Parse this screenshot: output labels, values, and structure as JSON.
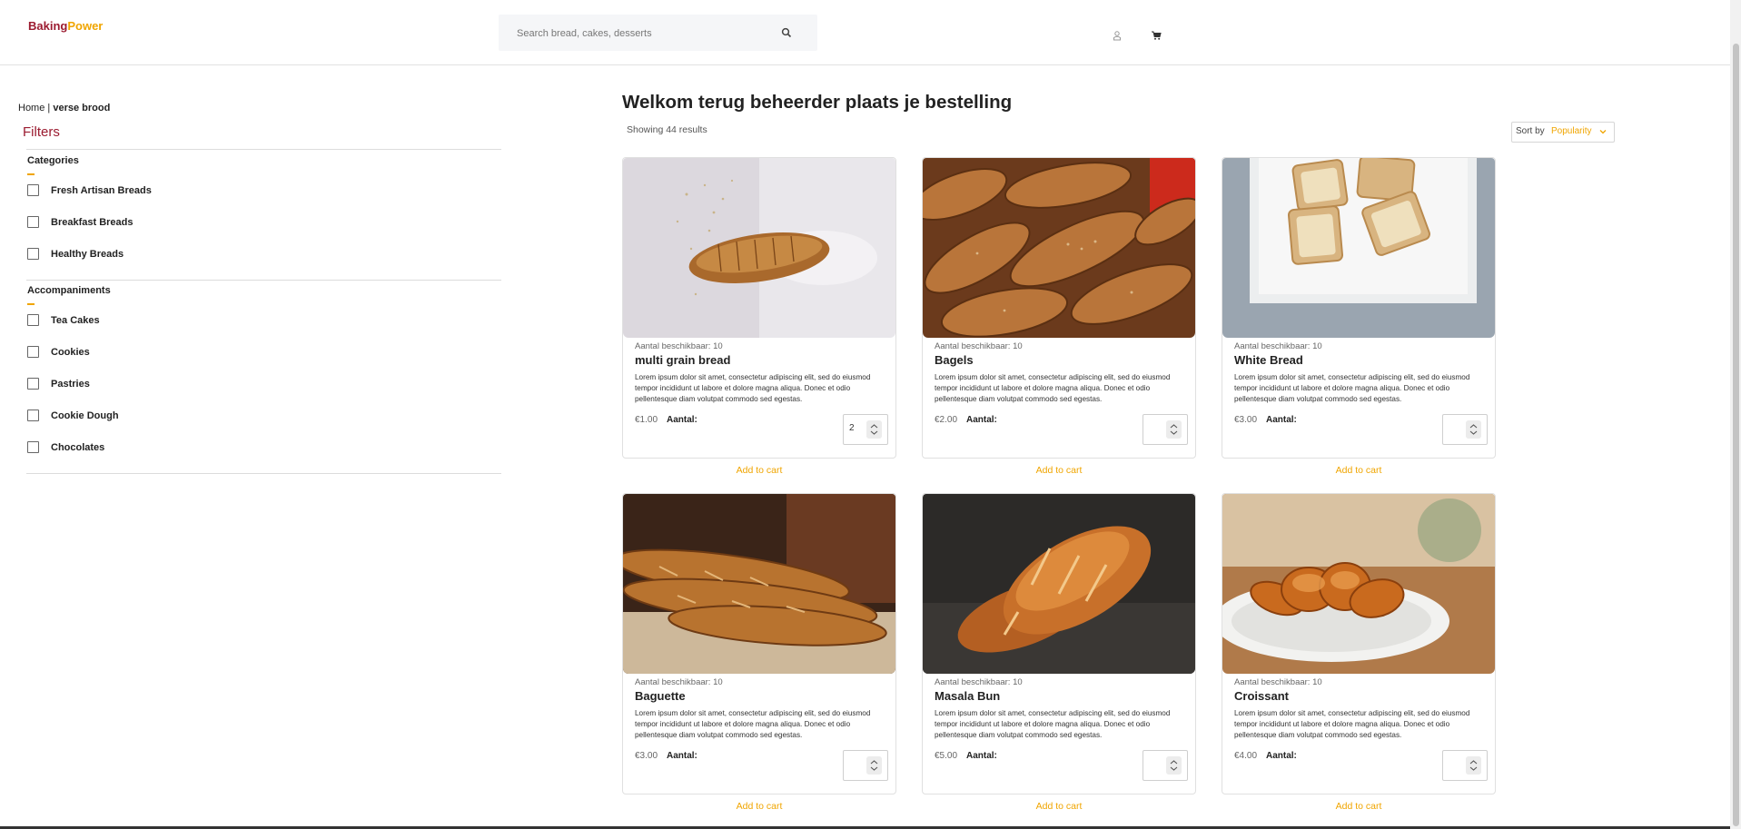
{
  "header": {
    "logo_part1": "Baking",
    "logo_part2": "Power",
    "search_placeholder": "Search bread, cakes, desserts",
    "icons": [
      "search-icon",
      "user-icon",
      "cart-icon"
    ]
  },
  "breadcrumb": {
    "home": "Home",
    "separator": " | ",
    "current": "verse brood"
  },
  "sidebar": {
    "title": "Filters",
    "groups": [
      {
        "title": "Categories",
        "items": [
          "Fresh Artisan Breads",
          "Breakfast Breads",
          "Healthy Breads"
        ]
      },
      {
        "title": "Accompaniments",
        "items": [
          "Tea Cakes",
          "Cookies",
          "Pastries",
          "Cookie Dough",
          "Chocolates"
        ]
      }
    ]
  },
  "main": {
    "title": "Welkom terug beheerder plaats je bestelling",
    "results": "Showing 44 results",
    "sort_label": "Sort by",
    "sort_value": "Popularity"
  },
  "products": [
    {
      "name": "multi grain bread",
      "price": "€1.00",
      "stock": "Aantal beschikbaar: 10",
      "qty": "2",
      "desc": "Lorem ipsum dolor sit amet, consectetur adipiscing elit, sed do eiusmod tempor incididunt ut labore et dolore magna aliqua. Donec et odio pellentesque diam volutpat commodo sed egestas.",
      "qty_label": "Aantal:",
      "add": "Add to cart"
    },
    {
      "name": "Bagels",
      "price": "€2.00",
      "stock": "Aantal beschikbaar: 10",
      "qty": "",
      "desc": "Lorem ipsum dolor sit amet, consectetur adipiscing elit, sed do eiusmod tempor incididunt ut labore et dolore magna aliqua. Donec et odio pellentesque diam volutpat commodo sed egestas.",
      "qty_label": "Aantal:",
      "add": "Add to cart"
    },
    {
      "name": "White Bread",
      "price": "€3.00",
      "stock": "Aantal beschikbaar: 10",
      "qty": "",
      "desc": "Lorem ipsum dolor sit amet, consectetur adipiscing elit, sed do eiusmod tempor incididunt ut labore et dolore magna aliqua. Donec et odio pellentesque diam volutpat commodo sed egestas.",
      "qty_label": "Aantal:",
      "add": "Add to cart"
    },
    {
      "name": "Baguette",
      "price": "€3.00",
      "stock": "Aantal beschikbaar: 10",
      "qty": "",
      "desc": "Lorem ipsum dolor sit amet, consectetur adipiscing elit, sed do eiusmod tempor incididunt ut labore et dolore magna aliqua. Donec et odio pellentesque diam volutpat commodo sed egestas.",
      "qty_label": "Aantal:",
      "add": "Add to cart"
    },
    {
      "name": "Masala Bun",
      "price": "€5.00",
      "stock": "Aantal beschikbaar: 10",
      "qty": "",
      "desc": "Lorem ipsum dolor sit amet, consectetur adipiscing elit, sed do eiusmod tempor incididunt ut labore et dolore magna aliqua. Donec et odio pellentesque diam volutpat commodo sed egestas.",
      "qty_label": "Aantal:",
      "add": "Add to cart"
    },
    {
      "name": "Croissant",
      "price": "€4.00",
      "stock": "Aantal beschikbaar: 10",
      "qty": "",
      "desc": "Lorem ipsum dolor sit amet, consectetur adipiscing elit, sed do eiusmod tempor incididunt ut labore et dolore magna aliqua. Donec et odio pellentesque diam volutpat commodo sed egestas.",
      "qty_label": "Aantal:",
      "add": "Add to cart"
    }
  ],
  "colors": {
    "brand_red": "#9b1b30",
    "accent": "#f0a500"
  }
}
